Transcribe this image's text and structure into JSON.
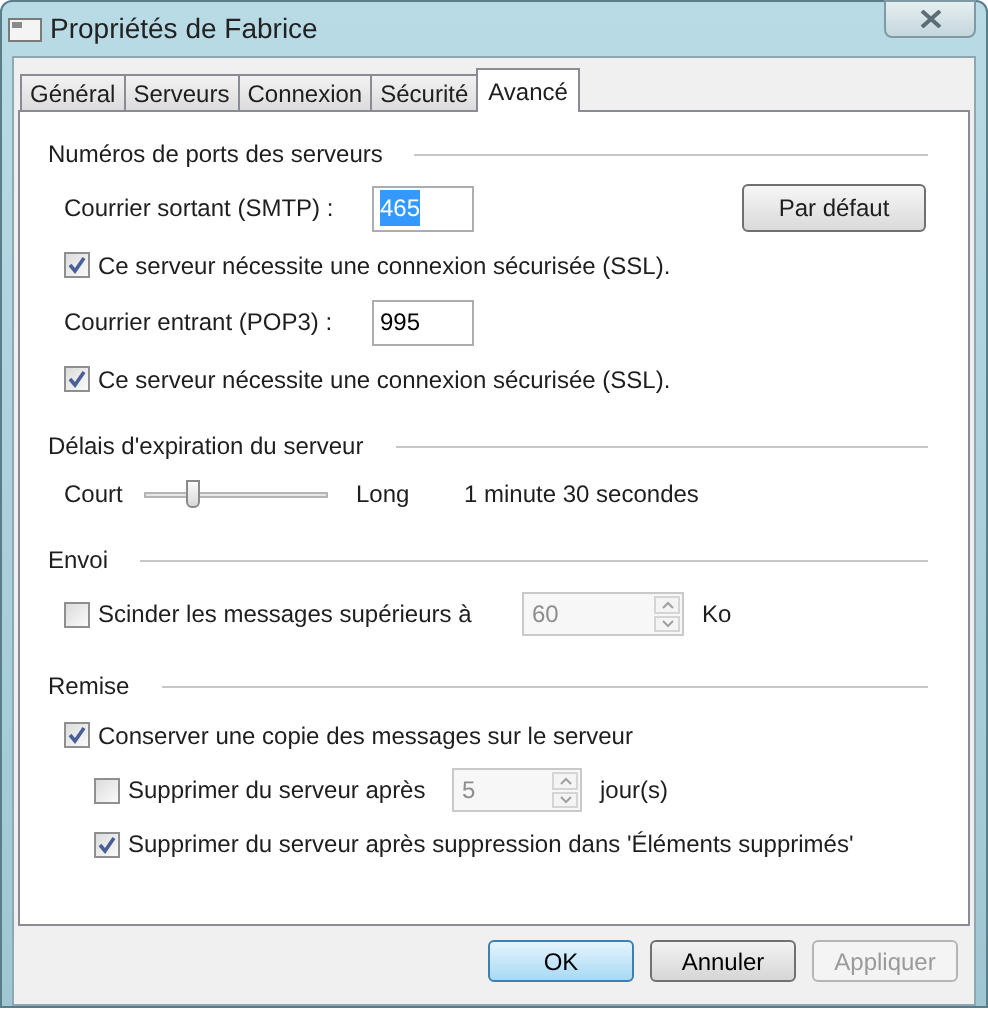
{
  "window": {
    "title": "Propriétés de Fabrice"
  },
  "tabs": [
    {
      "label": "Général",
      "selected": false
    },
    {
      "label": "Serveurs",
      "selected": false
    },
    {
      "label": "Connexion",
      "selected": false
    },
    {
      "label": "Sécurité",
      "selected": false
    },
    {
      "label": "Avancé",
      "selected": true
    }
  ],
  "sections": [
    {
      "title": "Numéros de ports des serveurs",
      "items": [
        {
          "kind": "port",
          "label": "Courrier sortant (SMTP) :",
          "value": "465",
          "selected": true,
          "button": "Par défaut"
        },
        {
          "kind": "checkbox",
          "label": "Ce serveur nécessite une connexion sécurisée (SSL).",
          "checked": true
        },
        {
          "kind": "port",
          "label": "Courrier entrant (POP3) :",
          "value": "995",
          "selected": false
        },
        {
          "kind": "checkbox",
          "label": "Ce serveur nécessite une connexion sécurisée (SSL).",
          "checked": true
        }
      ]
    },
    {
      "title": "Délais d'expiration du serveur",
      "items": [
        {
          "kind": "slider",
          "min_label": "Court",
          "max_label": "Long",
          "level": 0.25,
          "reading": "1 minute 30 secondes"
        }
      ]
    },
    {
      "title": "Envoi",
      "items": [
        {
          "kind": "checkbox-spin",
          "label": "Scinder les messages supérieurs à",
          "checked": false,
          "value": "60",
          "disabled": true,
          "unit": "Ko"
        }
      ]
    },
    {
      "title": "Remise",
      "items": [
        {
          "kind": "checkbox",
          "label": "Conserver une copie des messages sur le serveur",
          "checked": true,
          "children": [
            {
              "kind": "checkbox-spin",
              "label": "Supprimer du serveur après",
              "checked": false,
              "value": "5",
              "disabled": true,
              "unit": "jour(s)"
            },
            {
              "kind": "checkbox",
              "label": "Supprimer du serveur après suppression dans 'Éléments supprimés'",
              "checked": true
            }
          ]
        }
      ]
    }
  ],
  "buttons": [
    {
      "label": "OK",
      "default": true,
      "disabled": false
    },
    {
      "label": "Annuler",
      "default": false,
      "disabled": false
    },
    {
      "label": "Appliquer",
      "default": false,
      "disabled": true
    }
  ]
}
